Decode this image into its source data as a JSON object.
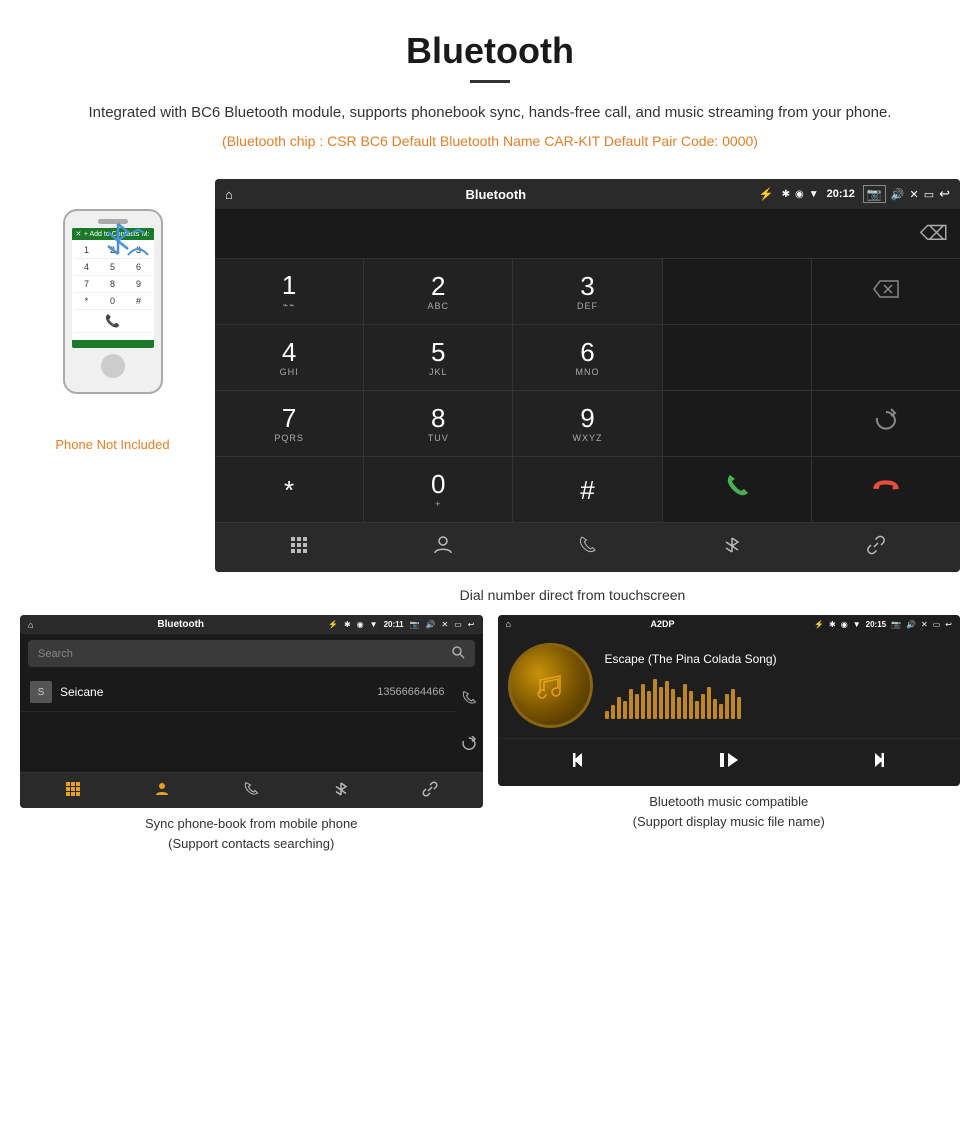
{
  "header": {
    "title": "Bluetooth",
    "description": "Integrated with BC6 Bluetooth module, supports phonebook sync, hands-free call, and music streaming from your phone.",
    "specs": "(Bluetooth chip : CSR BC6    Default Bluetooth Name CAR-KIT    Default Pair Code: 0000)"
  },
  "phone_label": "Phone Not Included",
  "dial_screen": {
    "status_bar": {
      "title": "Bluetooth",
      "time": "20:12"
    },
    "keys": [
      {
        "main": "1",
        "sub": "⌁⌁"
      },
      {
        "main": "2",
        "sub": "ABC"
      },
      {
        "main": "3",
        "sub": "DEF"
      },
      {
        "main": "",
        "sub": ""
      },
      {
        "main": "⌫",
        "sub": ""
      },
      {
        "main": "4",
        "sub": "GHI"
      },
      {
        "main": "5",
        "sub": "JKL"
      },
      {
        "main": "6",
        "sub": "MNO"
      },
      {
        "main": "",
        "sub": ""
      },
      {
        "main": "",
        "sub": ""
      },
      {
        "main": "7",
        "sub": "PQRS"
      },
      {
        "main": "8",
        "sub": "TUV"
      },
      {
        "main": "9",
        "sub": "WXYZ"
      },
      {
        "main": "",
        "sub": ""
      },
      {
        "main": "↻",
        "sub": ""
      },
      {
        "main": "*",
        "sub": ""
      },
      {
        "main": "0",
        "sub": "+"
      },
      {
        "main": "#",
        "sub": ""
      },
      {
        "main": "📞",
        "sub": ""
      },
      {
        "main": "📞",
        "sub": "end"
      }
    ],
    "bottom_nav": [
      "⋮⋮⋮",
      "👤",
      "📞",
      "✱",
      "🔗"
    ]
  },
  "dial_caption": "Dial number direct from touchscreen",
  "phonebook_screen": {
    "status_bar": {
      "title": "Bluetooth",
      "time": "20:11"
    },
    "search_placeholder": "Search",
    "contacts": [
      {
        "avatar_letter": "S",
        "name": "Seicane",
        "number": "13566664466"
      }
    ],
    "right_icons": [
      "📞",
      "↻"
    ],
    "bottom_nav": [
      "⋮⋮",
      "👤",
      "📞",
      "✱",
      "🔗"
    ]
  },
  "phonebook_caption_line1": "Sync phone-book from mobile phone",
  "phonebook_caption_line2": "(Support contacts searching)",
  "music_screen": {
    "status_bar": {
      "title": "A2DP",
      "time": "20:15"
    },
    "song_title": "Escape (The Pina Colada Song)",
    "visualizer_heights": [
      8,
      14,
      22,
      18,
      30,
      25,
      35,
      28,
      40,
      32,
      38,
      30,
      22,
      35,
      28,
      18,
      25,
      32,
      20,
      15,
      25,
      30,
      22
    ],
    "controls": [
      "⏮",
      "⏯",
      "⏭"
    ]
  },
  "music_caption_line1": "Bluetooth music compatible",
  "music_caption_line2": "(Support display music file name)"
}
